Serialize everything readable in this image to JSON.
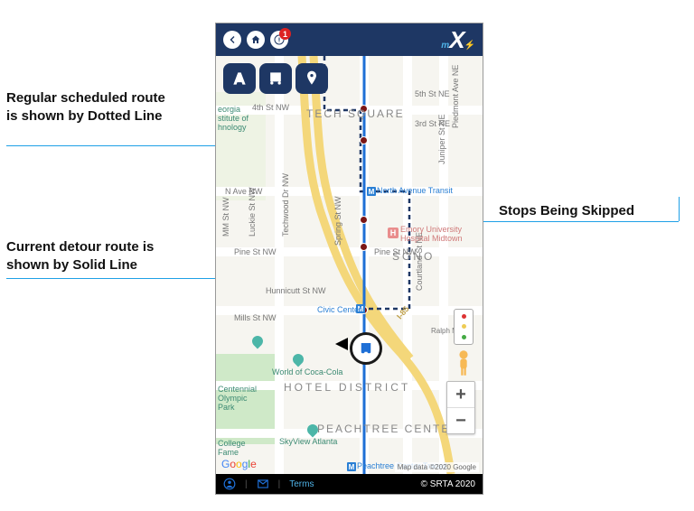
{
  "header": {
    "alert_count": "1",
    "logo_prefix": "m",
    "logo_main": "X"
  },
  "toolbox": {
    "btn1_name": "highway-icon",
    "btn2_name": "bus-stop-icon",
    "btn3_name": "place-pin-icon"
  },
  "map": {
    "districts": {
      "tech_square": "TECH SQUARE",
      "sono": "SONO",
      "hotel_district": "HOTEL DISTRICT",
      "peachtree_center": "PEACHTREE CENTER"
    },
    "streets": {
      "fourth": "4th St NW",
      "nave": "N Ave NW",
      "pine": "Pine St NW",
      "hunnicutt": "Hunnicutt St NW",
      "mills": "Mills St NW",
      "fifth_ne": "5th St NE",
      "third_ne": "3rd St NE",
      "piedmont": "Piedmont Ave NE",
      "juniper": "Juniper St NE",
      "courtland": "Courtland St NE",
      "luckie": "Luckie St NW",
      "techwood": "Techwood Dr NW",
      "spring": "Spring St NW",
      "i85": "I-85",
      "mm_nw": "MM St NW",
      "ralph_mcgill": "Ralph McGill"
    },
    "transit": {
      "north_ave": "North Avenue Transit",
      "civic_center": "Civic Center",
      "peachtree_center": "Peachtree Center Transit"
    },
    "poi": {
      "ga_tech": "eorgia\nstitute of\nhnology",
      "world_coke": "World of Coca-Cola",
      "centennial": "Centennial\nOlympic\nPark",
      "skyview": "SkyView Atlanta",
      "college_fame": "College\nFame",
      "emory": "Emory University\nHospital Midtown"
    },
    "brand": "Google",
    "attribution": "Map data ©2020 Google"
  },
  "zoom": {
    "plus": "+",
    "minus": "−"
  },
  "footer": {
    "terms": "Terms",
    "copyright": "© SRTA 2020"
  },
  "annotations": {
    "dotted": "Regular scheduled route is shown by Dotted Line",
    "solid": "Current detour route is shown by Solid Line",
    "skipped": "Stops Being Skipped"
  }
}
